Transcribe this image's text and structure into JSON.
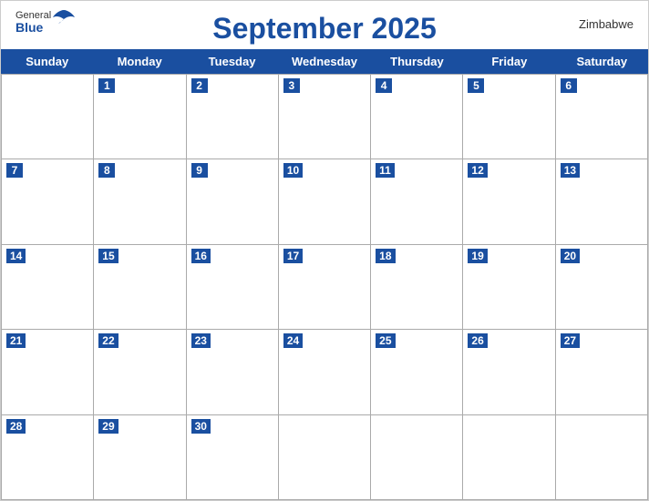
{
  "header": {
    "logo_general": "General",
    "logo_blue": "Blue",
    "title": "September 2025",
    "country": "Zimbabwe"
  },
  "days": {
    "names": [
      "Sunday",
      "Monday",
      "Tuesday",
      "Wednesday",
      "Thursday",
      "Friday",
      "Saturday"
    ]
  },
  "weeks": [
    [
      {
        "num": "",
        "empty": true
      },
      {
        "num": "1",
        "empty": false
      },
      {
        "num": "2",
        "empty": false
      },
      {
        "num": "3",
        "empty": false
      },
      {
        "num": "4",
        "empty": false
      },
      {
        "num": "5",
        "empty": false
      },
      {
        "num": "6",
        "empty": false
      }
    ],
    [
      {
        "num": "7",
        "empty": false
      },
      {
        "num": "8",
        "empty": false
      },
      {
        "num": "9",
        "empty": false
      },
      {
        "num": "10",
        "empty": false
      },
      {
        "num": "11",
        "empty": false
      },
      {
        "num": "12",
        "empty": false
      },
      {
        "num": "13",
        "empty": false
      }
    ],
    [
      {
        "num": "14",
        "empty": false
      },
      {
        "num": "15",
        "empty": false
      },
      {
        "num": "16",
        "empty": false
      },
      {
        "num": "17",
        "empty": false
      },
      {
        "num": "18",
        "empty": false
      },
      {
        "num": "19",
        "empty": false
      },
      {
        "num": "20",
        "empty": false
      }
    ],
    [
      {
        "num": "21",
        "empty": false
      },
      {
        "num": "22",
        "empty": false
      },
      {
        "num": "23",
        "empty": false
      },
      {
        "num": "24",
        "empty": false
      },
      {
        "num": "25",
        "empty": false
      },
      {
        "num": "26",
        "empty": false
      },
      {
        "num": "27",
        "empty": false
      }
    ],
    [
      {
        "num": "28",
        "empty": false
      },
      {
        "num": "29",
        "empty": false
      },
      {
        "num": "30",
        "empty": false
      },
      {
        "num": "",
        "empty": true
      },
      {
        "num": "",
        "empty": true
      },
      {
        "num": "",
        "empty": true
      },
      {
        "num": "",
        "empty": true
      }
    ]
  ]
}
